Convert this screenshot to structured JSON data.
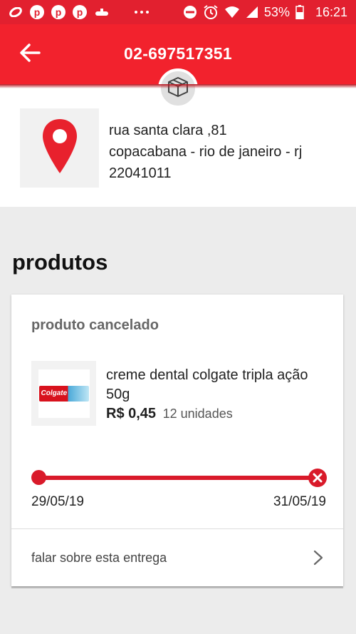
{
  "status_bar": {
    "battery": "53%",
    "time": "16:21",
    "icons": [
      "ring-icon",
      "pinterest-icon",
      "pinterest-icon",
      "pinterest-icon",
      "submarine-icon",
      "more-icon",
      "do-not-disturb-icon",
      "alarm-icon",
      "wifi-icon",
      "signal-icon",
      "battery-icon"
    ]
  },
  "header": {
    "title": "02-697517351",
    "back_icon": "arrow-left-icon",
    "package_icon": "package-icon"
  },
  "address": {
    "pin_icon": "location-pin-icon",
    "line1": "rua santa clara ,81",
    "line2": "copacabana - rio de janeiro - rj",
    "line3": "22041011"
  },
  "section": {
    "title": "produtos"
  },
  "product_card": {
    "status": "produto cancelado",
    "product_name": "creme dental colgate tripla ação 50g",
    "brand_text": "Colgate",
    "price": "R$ 0,45",
    "quantity": "12 unidades",
    "start_date": "29/05/19",
    "end_date": "31/05/19",
    "progress": 1.0,
    "delivery_link": "falar sobre esta entrega"
  },
  "colors": {
    "primary": "#f2222d",
    "accent": "#d91a2a",
    "background": "#ececec"
  }
}
